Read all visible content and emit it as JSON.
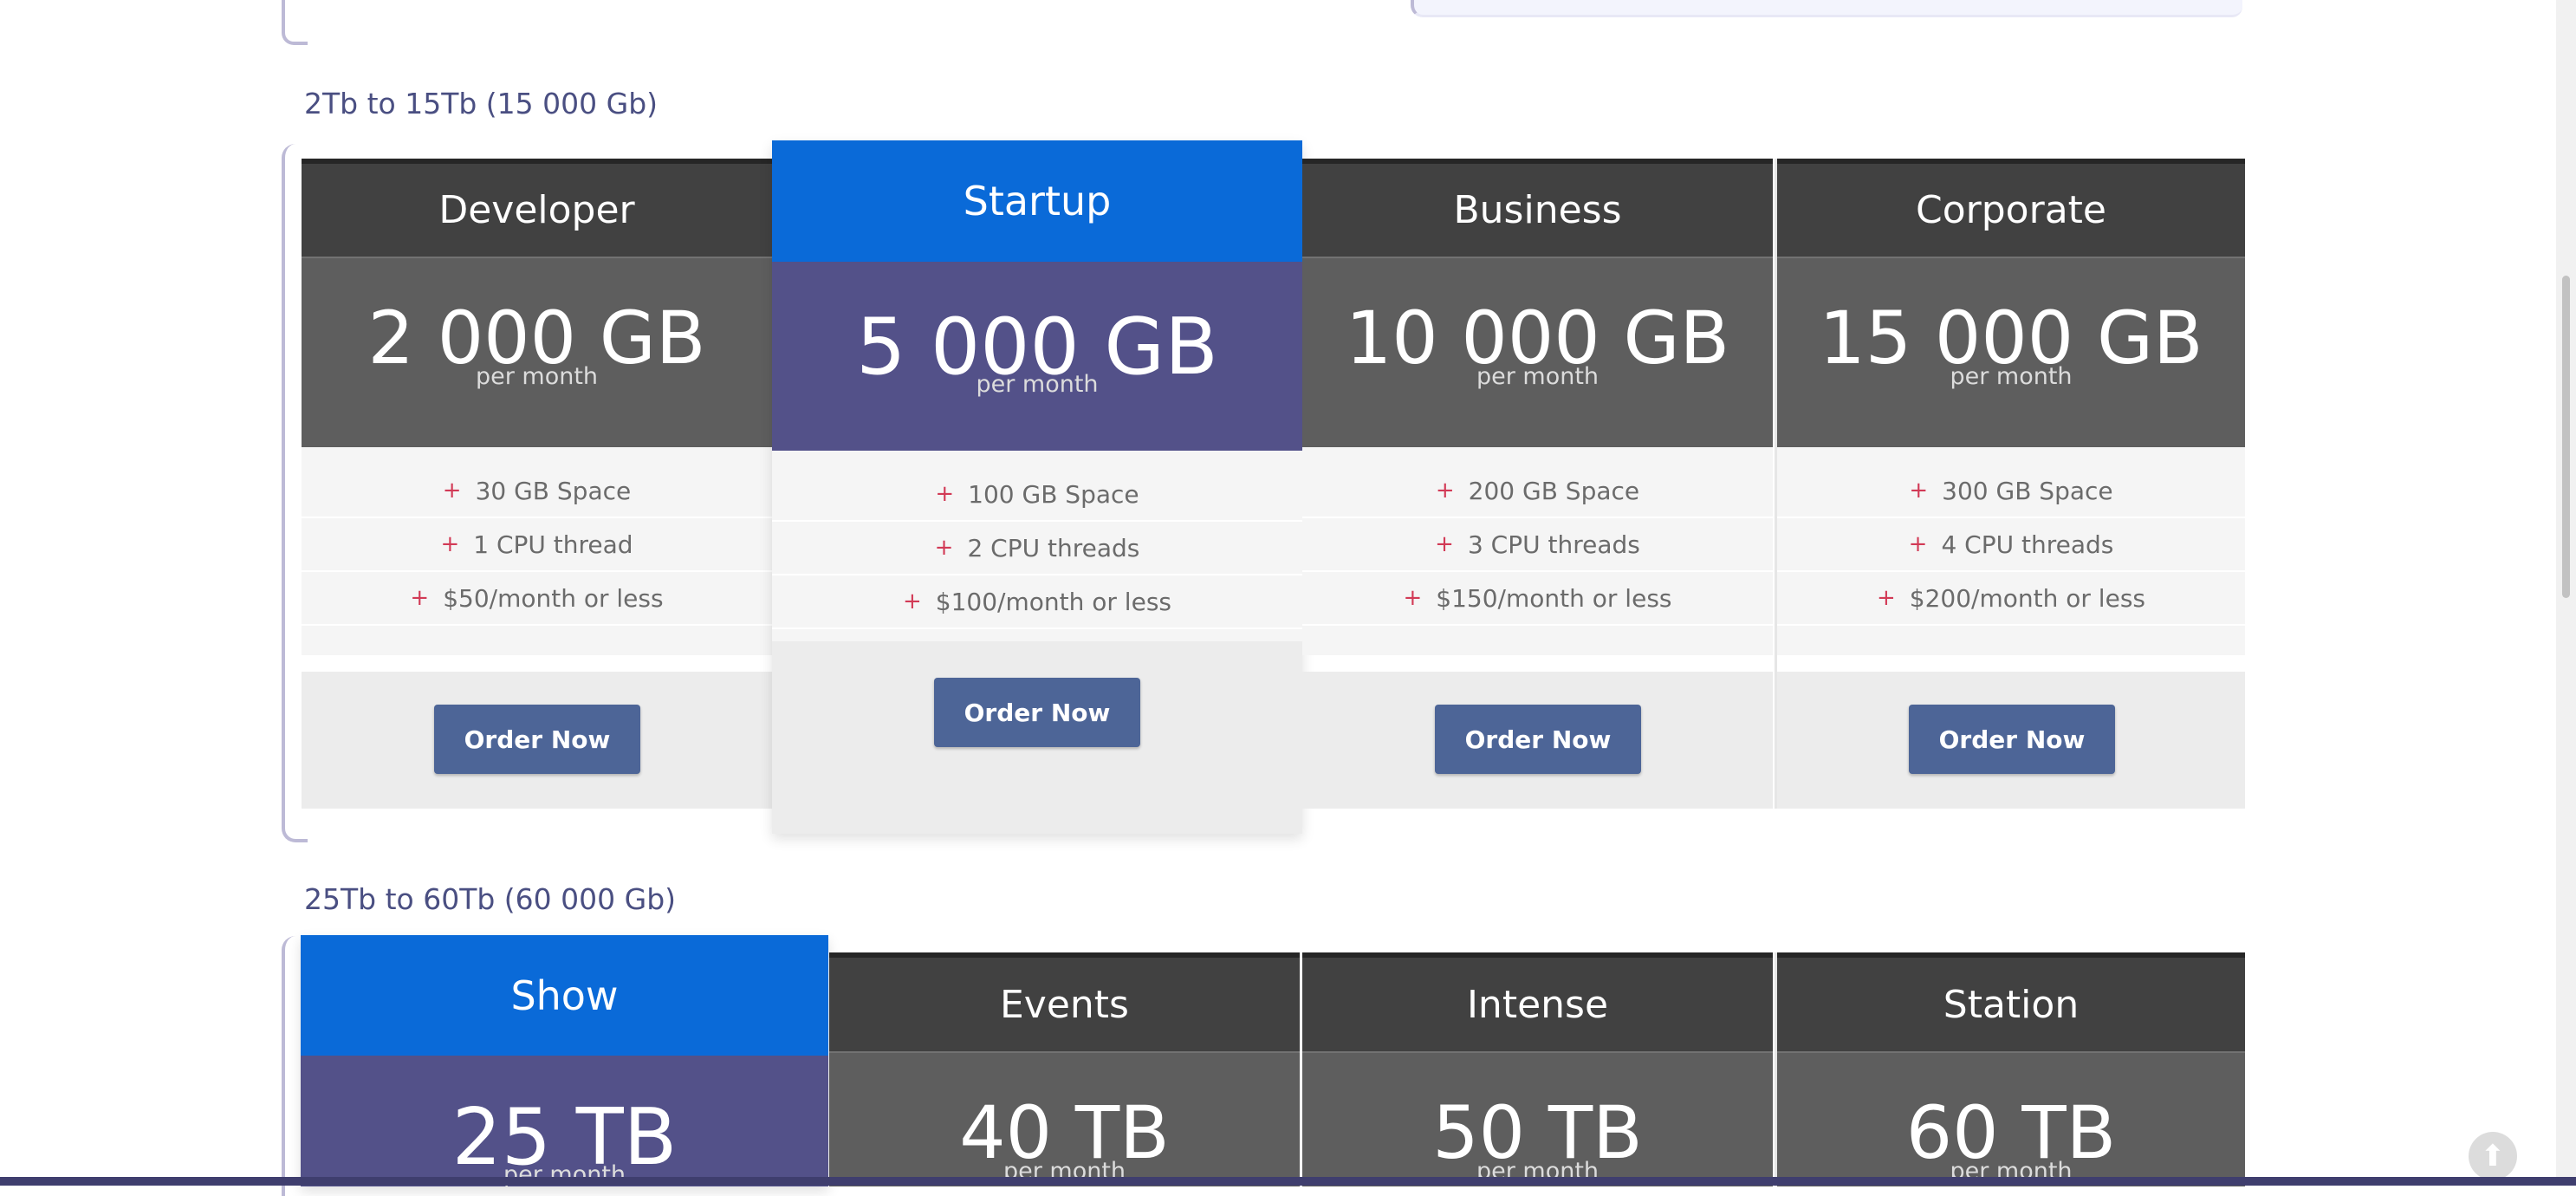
{
  "section_1": {
    "title": "2Tb to 15Tb (15 000 Gb)",
    "plans": [
      {
        "name": "Developer",
        "amount": "2 000 GB",
        "period": "per month",
        "features": [
          "30 GB Space",
          "1 CPU thread",
          "$50/month or less"
        ],
        "button": "Order Now"
      },
      {
        "name": "Startup",
        "amount": "5 000 GB",
        "period": "per month",
        "features": [
          "100 GB Space",
          "2 CPU threads",
          "$100/month or less"
        ],
        "button": "Order Now"
      },
      {
        "name": "Business",
        "amount": "10 000 GB",
        "period": "per month",
        "features": [
          "200 GB Space",
          "3 CPU threads",
          "$150/month or less"
        ],
        "button": "Order Now"
      },
      {
        "name": "Corporate",
        "amount": "15 000 GB",
        "period": "per month",
        "features": [
          "300 GB Space",
          "4 CPU threads",
          "$200/month or less"
        ],
        "button": "Order Now"
      }
    ]
  },
  "section_2": {
    "title": "25Tb to 60Tb (60 000 Gb)",
    "plans": [
      {
        "name": "Show",
        "amount": "25 TB",
        "period": "per month"
      },
      {
        "name": "Events",
        "amount": "40 TB",
        "period": "per month"
      },
      {
        "name": "Intense",
        "amount": "50 TB",
        "period": "per month"
      },
      {
        "name": "Station",
        "amount": "60 TB",
        "period": "per month"
      }
    ]
  },
  "icons": {
    "feature_bullet": "+",
    "back_to_top": "⬆"
  },
  "colors": {
    "featured_header": "#0a6ad8",
    "featured_price": "#535189",
    "button": "#4d6597",
    "bullet": "#d23a56"
  }
}
